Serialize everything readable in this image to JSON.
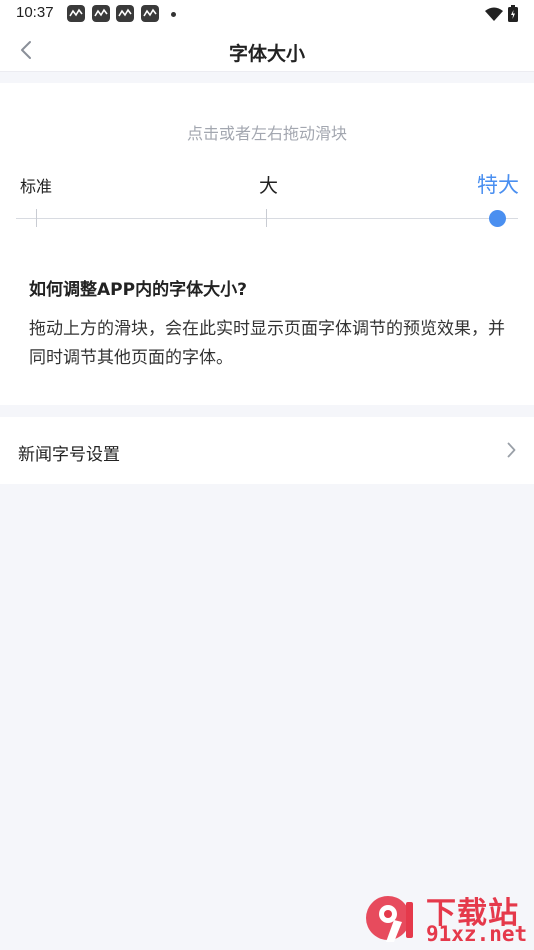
{
  "status_bar": {
    "time": "10:37",
    "notification_icons": [
      "app-notification-icon",
      "app-notification-icon",
      "app-notification-icon",
      "app-notification-icon"
    ],
    "more_dot": "•"
  },
  "nav": {
    "back_icon": "chevron-left-icon",
    "title": "字体大小"
  },
  "slider": {
    "hint": "点击或者左右拖动滑块",
    "labels": [
      "标准",
      "大",
      "特大"
    ],
    "selected_index": 2,
    "accent_color": "#4a8ff0"
  },
  "faq": {
    "title": "如何调整APP内的字体大小?",
    "body": "拖动上方的滑块，会在此实时显示页面字体调节的预览效果，并同时调节其他页面的字体。"
  },
  "settings": {
    "news_font_label": "新闻字号设置",
    "chevron_icon": "chevron-right-icon"
  },
  "watermark": {
    "line1": "下载站",
    "line2": "91xz.net"
  }
}
